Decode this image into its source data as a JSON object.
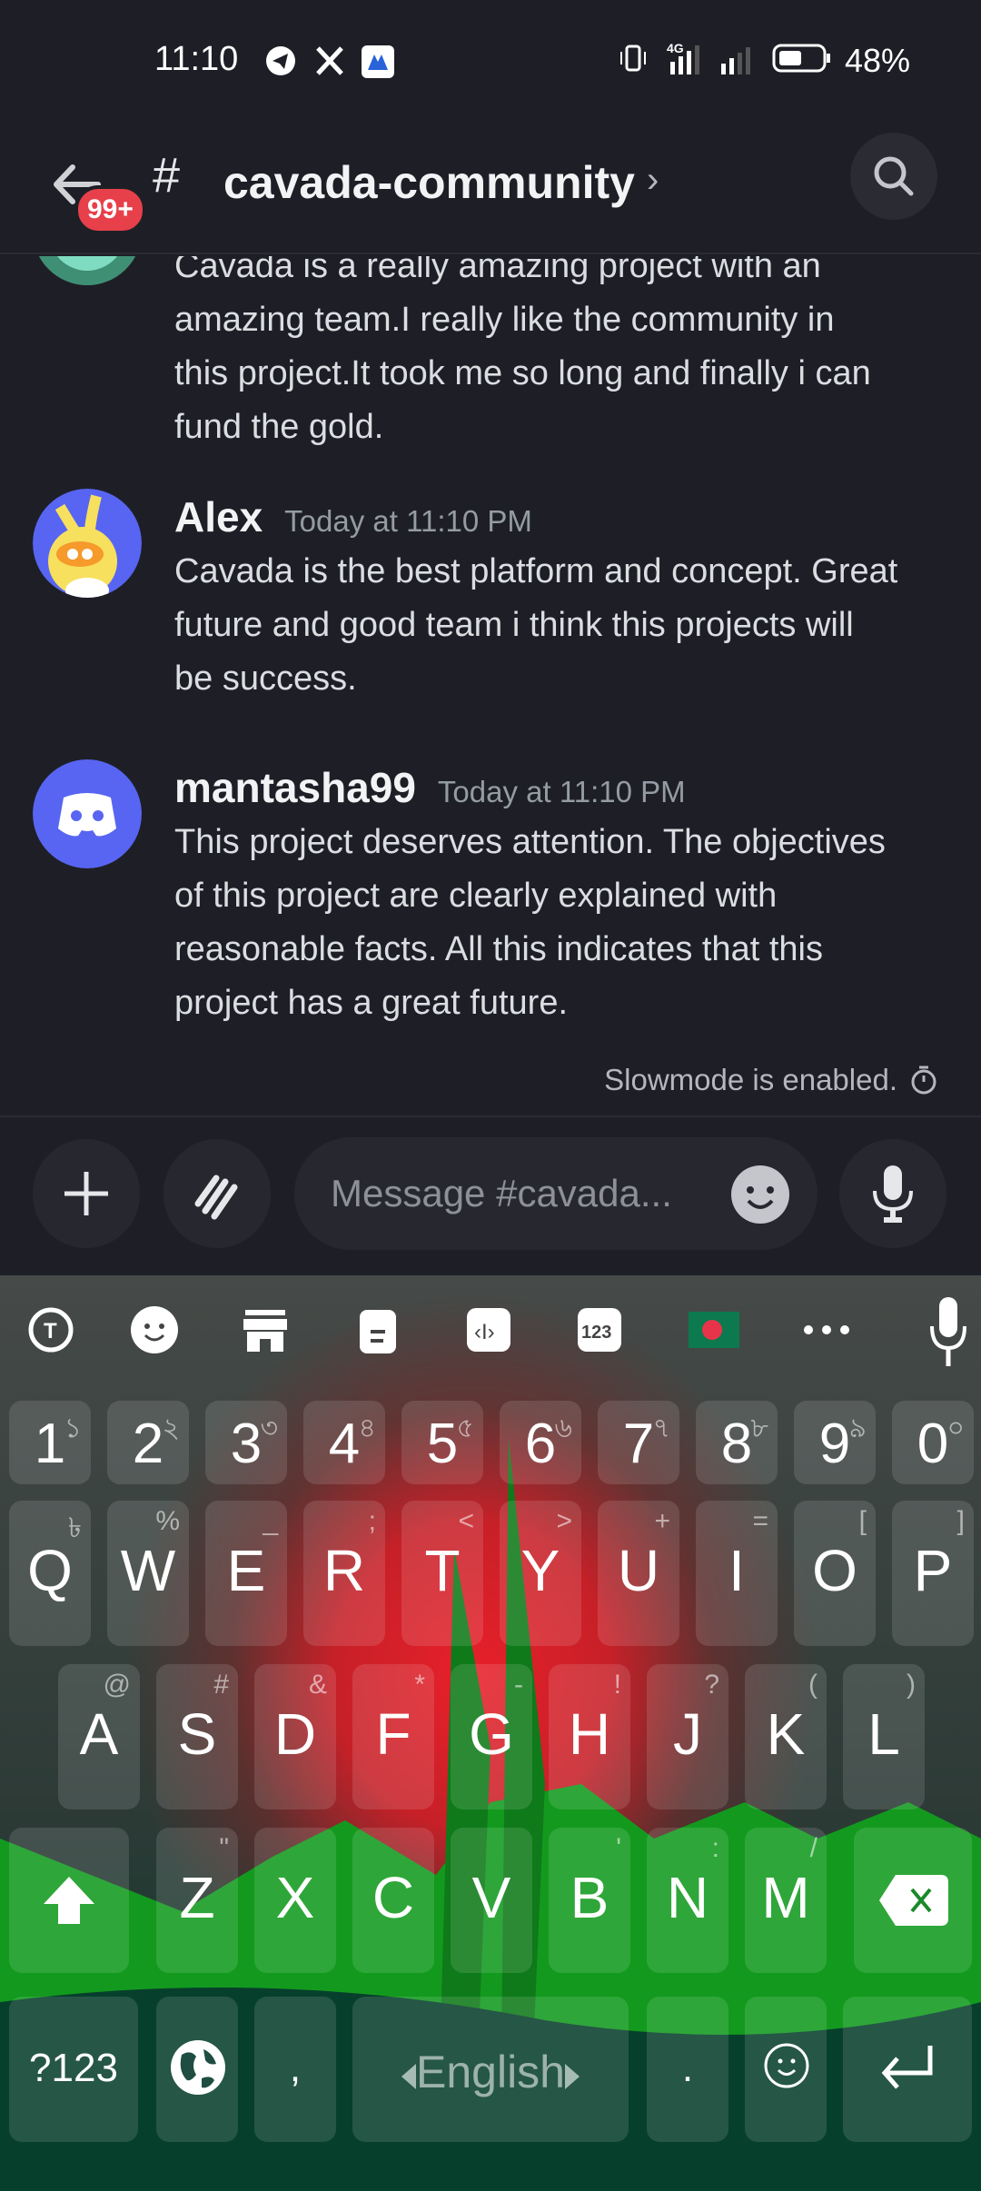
{
  "status_bar": {
    "time": "11:10",
    "notification_icons": [
      "telegram-icon",
      "x-icon",
      "app-icon"
    ],
    "network": "4G",
    "battery_percent": "48%",
    "battery_level": 0.48
  },
  "header": {
    "back_badge": "99+",
    "channel_prefix": "#",
    "channel_name": "cavada-community",
    "chevron": "›"
  },
  "messages": [
    {
      "author": "",
      "timestamp": "",
      "lines": [
        "Cavada is a really amazing project with an",
        "amazing team.I really like the community in",
        "this project.It took me so long and finally i can",
        "fund the gold."
      ]
    },
    {
      "author": "Alex",
      "timestamp": "Today at 11:10 PM",
      "lines": [
        "Cavada is the best platform and concept. Great",
        "future and good team i think this projects will",
        "be success."
      ]
    },
    {
      "author": "mantasha99",
      "timestamp": "Today at 11:10 PM",
      "lines": [
        "This project deserves attention. The objectives",
        "of this project are clearly explained with",
        "reasonable facts. All this indicates that this",
        "project has a great future."
      ]
    }
  ],
  "slowmode": "Slowmode is enabled.",
  "composer": {
    "placeholder": "Message #cavada..."
  },
  "keyboard": {
    "toolbar": [
      "translate-icon",
      "emoji-icon",
      "store-icon",
      "clipboard-icon",
      "text-edit-icon",
      "numpad-icon",
      "bangladesh-flag-icon",
      "more-icon",
      "mic-icon"
    ],
    "number_row": [
      {
        "key": "1",
        "hint": "১"
      },
      {
        "key": "2",
        "hint": "২"
      },
      {
        "key": "3",
        "hint": "৩"
      },
      {
        "key": "4",
        "hint": "৪"
      },
      {
        "key": "5",
        "hint": "৫"
      },
      {
        "key": "6",
        "hint": "৬"
      },
      {
        "key": "7",
        "hint": "৭"
      },
      {
        "key": "8",
        "hint": "৮"
      },
      {
        "key": "9",
        "hint": "৯"
      },
      {
        "key": "0",
        "hint": "০"
      }
    ],
    "row1": [
      {
        "key": "Q",
        "hint": "৳"
      },
      {
        "key": "W",
        "hint": "%"
      },
      {
        "key": "E",
        "hint": "_"
      },
      {
        "key": "R",
        "hint": ";"
      },
      {
        "key": "T",
        "hint": "<"
      },
      {
        "key": "Y",
        "hint": ">"
      },
      {
        "key": "U",
        "hint": "+"
      },
      {
        "key": "I",
        "hint": "="
      },
      {
        "key": "O",
        "hint": "["
      },
      {
        "key": "P",
        "hint": "]"
      }
    ],
    "row2": [
      {
        "key": "A",
        "hint": "@"
      },
      {
        "key": "S",
        "hint": "#"
      },
      {
        "key": "D",
        "hint": "&"
      },
      {
        "key": "F",
        "hint": "*"
      },
      {
        "key": "G",
        "hint": "-"
      },
      {
        "key": "H",
        "hint": "!"
      },
      {
        "key": "J",
        "hint": "?"
      },
      {
        "key": "K",
        "hint": "("
      },
      {
        "key": "L",
        "hint": ")"
      }
    ],
    "row3": [
      {
        "key": "Z",
        "hint": "\""
      },
      {
        "key": "X",
        "hint": ""
      },
      {
        "key": "C",
        "hint": ""
      },
      {
        "key": "V",
        "hint": ""
      },
      {
        "key": "B",
        "hint": "'"
      },
      {
        "key": "N",
        "hint": ":"
      },
      {
        "key": "M",
        "hint": "/"
      }
    ],
    "bottom": {
      "symbols": "?123",
      "comma": ",",
      "space": "English",
      "period": "."
    }
  }
}
